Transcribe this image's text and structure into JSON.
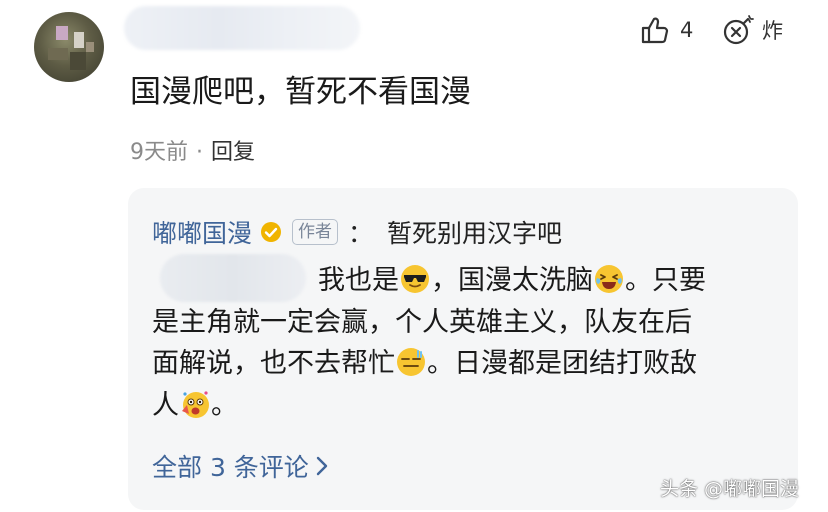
{
  "comment": {
    "text": "国漫爬吧，暂死不看国漫",
    "time": "9天前",
    "separator": "·",
    "reply_label": "回复",
    "like_icon": "thumbs-up-icon",
    "like_count": "4",
    "bomb_icon": "bomb-icon",
    "bomb_label": "炸"
  },
  "reply": {
    "author": "嘟嘟国漫",
    "verified_icon": "verified-badge-icon",
    "verified_color": "#f0b400",
    "author_tag": "作者",
    "colon": "：",
    "quote": "暂死别用汉字吧",
    "body": {
      "line1_a": "我也是",
      "line1_b": "，国漫太洗脑",
      "line1_c": "。只要",
      "line2": "是主角就一定会赢，个人英雄主义，队友在后",
      "line3_a": "面解说，也不去帮忙",
      "line3_b": "。日漫都是团结打败敌",
      "line4_a": "人",
      "line4_b": "。"
    },
    "emojis": [
      "sunglasses-emoji",
      "laughing-tears-emoji",
      "sweat-smile-emoji",
      "party-emoji"
    ],
    "all_replies_label": "全部 3 条评论",
    "accent_color": "#406599"
  },
  "watermark": "头条 @嘟嘟国漫"
}
